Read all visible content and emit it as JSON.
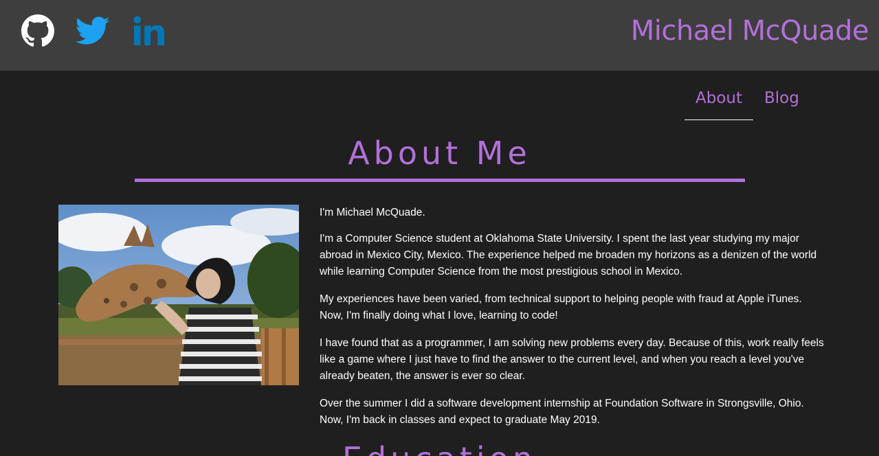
{
  "header": {
    "brand": "Michael McQuade",
    "social": [
      {
        "icon": "github-icon",
        "color": "#ffffff"
      },
      {
        "icon": "twitter-icon",
        "color": "#1da1f2"
      },
      {
        "icon": "linkedin-icon",
        "color": "#0077b5"
      }
    ]
  },
  "nav": {
    "items": [
      "About",
      "Blog"
    ],
    "active": "About"
  },
  "about": {
    "title": "About Me",
    "paragraphs": [
      "I'm Michael McQuade.",
      "I'm a Computer Science student at Oklahoma State University. I spent the last year studying my major abroad in Mexico City, Mexico. The experience helped me broaden my horizons as a denizen of the world while learning Computer Science from the most prestigious school in Mexico.",
      "My experiences have been varied, from technical support to helping people with fraud at Apple iTunes. Now, I'm finally doing what I love, learning to code!",
      "I have found that as a programmer, I am solving new problems every day. Because of this, work really feels like a game where I just have to find the answer to the current level, and when you reach a level you've already beaten, the answer is ever so clear.",
      "Over the summer I did a software development internship at Foundation Software in Strongsville, Ohio. Now, I'm back in classes and expect to graduate May 2019."
    ]
  },
  "next_section": {
    "title": "Education"
  },
  "colors": {
    "accent": "#b270d8",
    "header_bg": "#3e3e3e",
    "page_bg": "#1f1f1f"
  }
}
